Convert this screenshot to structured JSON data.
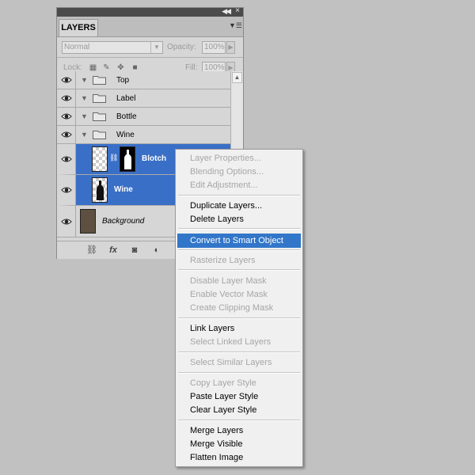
{
  "panel": {
    "tab_label": "LAYERS",
    "blend_mode": "Normal",
    "opacity_label": "Opacity:",
    "opacity_value": "100%",
    "lock_label": "Lock:",
    "fill_label": "Fill:",
    "fill_value": "100%"
  },
  "layers": [
    {
      "name": "Top",
      "type": "group",
      "selected": false
    },
    {
      "name": "Label",
      "type": "group",
      "selected": false
    },
    {
      "name": "Bottle",
      "type": "group",
      "selected": false
    },
    {
      "name": "Wine",
      "type": "group",
      "selected": false
    },
    {
      "name": "Blotch",
      "type": "layer-with-mask",
      "selected": true
    },
    {
      "name": "Wine",
      "type": "layer",
      "selected": true
    },
    {
      "name": "Background",
      "type": "background",
      "selected": false
    }
  ],
  "context_menu": {
    "items": [
      {
        "label": "Layer Properties...",
        "enabled": false
      },
      {
        "label": "Blending Options...",
        "enabled": false
      },
      {
        "label": "Edit Adjustment...",
        "enabled": false
      },
      {
        "label": "Duplicate Layers...",
        "enabled": true
      },
      {
        "label": "Delete Layers",
        "enabled": true
      },
      {
        "label": "Convert to Smart Object",
        "enabled": true,
        "highlighted": true
      },
      {
        "label": "Rasterize Layers",
        "enabled": false
      },
      {
        "label": "Disable Layer Mask",
        "enabled": false
      },
      {
        "label": "Enable Vector Mask",
        "enabled": false
      },
      {
        "label": "Create Clipping Mask",
        "enabled": false
      },
      {
        "label": "Link Layers",
        "enabled": true
      },
      {
        "label": "Select Linked Layers",
        "enabled": false
      },
      {
        "label": "Select Similar Layers",
        "enabled": false
      },
      {
        "label": "Copy Layer Style",
        "enabled": false
      },
      {
        "label": "Paste Layer Style",
        "enabled": true
      },
      {
        "label": "Clear Layer Style",
        "enabled": true
      },
      {
        "label": "Merge Layers",
        "enabled": true
      },
      {
        "label": "Merge Visible",
        "enabled": true
      },
      {
        "label": "Flatten Image",
        "enabled": true
      }
    ]
  },
  "colors": {
    "selection": "#3a6fc7",
    "menu_highlight": "#3276c9",
    "background_swatch": "#5e5040"
  }
}
